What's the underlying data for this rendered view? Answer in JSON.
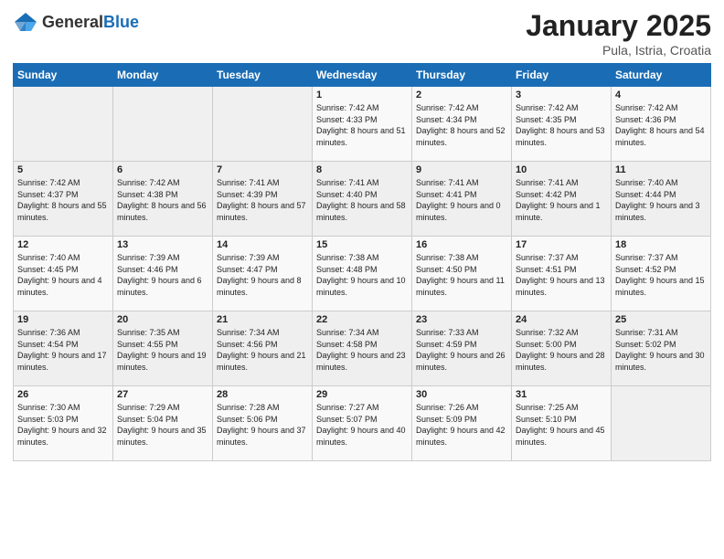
{
  "logo": {
    "general": "General",
    "blue": "Blue"
  },
  "header": {
    "title": "January 2025",
    "subtitle": "Pula, Istria, Croatia"
  },
  "weekdays": [
    "Sunday",
    "Monday",
    "Tuesday",
    "Wednesday",
    "Thursday",
    "Friday",
    "Saturday"
  ],
  "weeks": [
    [
      {
        "day": "",
        "info": ""
      },
      {
        "day": "",
        "info": ""
      },
      {
        "day": "",
        "info": ""
      },
      {
        "day": "1",
        "info": "Sunrise: 7:42 AM\nSunset: 4:33 PM\nDaylight: 8 hours and 51 minutes."
      },
      {
        "day": "2",
        "info": "Sunrise: 7:42 AM\nSunset: 4:34 PM\nDaylight: 8 hours and 52 minutes."
      },
      {
        "day": "3",
        "info": "Sunrise: 7:42 AM\nSunset: 4:35 PM\nDaylight: 8 hours and 53 minutes."
      },
      {
        "day": "4",
        "info": "Sunrise: 7:42 AM\nSunset: 4:36 PM\nDaylight: 8 hours and 54 minutes."
      }
    ],
    [
      {
        "day": "5",
        "info": "Sunrise: 7:42 AM\nSunset: 4:37 PM\nDaylight: 8 hours and 55 minutes."
      },
      {
        "day": "6",
        "info": "Sunrise: 7:42 AM\nSunset: 4:38 PM\nDaylight: 8 hours and 56 minutes."
      },
      {
        "day": "7",
        "info": "Sunrise: 7:41 AM\nSunset: 4:39 PM\nDaylight: 8 hours and 57 minutes."
      },
      {
        "day": "8",
        "info": "Sunrise: 7:41 AM\nSunset: 4:40 PM\nDaylight: 8 hours and 58 minutes."
      },
      {
        "day": "9",
        "info": "Sunrise: 7:41 AM\nSunset: 4:41 PM\nDaylight: 9 hours and 0 minutes."
      },
      {
        "day": "10",
        "info": "Sunrise: 7:41 AM\nSunset: 4:42 PM\nDaylight: 9 hours and 1 minute."
      },
      {
        "day": "11",
        "info": "Sunrise: 7:40 AM\nSunset: 4:44 PM\nDaylight: 9 hours and 3 minutes."
      }
    ],
    [
      {
        "day": "12",
        "info": "Sunrise: 7:40 AM\nSunset: 4:45 PM\nDaylight: 9 hours and 4 minutes."
      },
      {
        "day": "13",
        "info": "Sunrise: 7:39 AM\nSunset: 4:46 PM\nDaylight: 9 hours and 6 minutes."
      },
      {
        "day": "14",
        "info": "Sunrise: 7:39 AM\nSunset: 4:47 PM\nDaylight: 9 hours and 8 minutes."
      },
      {
        "day": "15",
        "info": "Sunrise: 7:38 AM\nSunset: 4:48 PM\nDaylight: 9 hours and 10 minutes."
      },
      {
        "day": "16",
        "info": "Sunrise: 7:38 AM\nSunset: 4:50 PM\nDaylight: 9 hours and 11 minutes."
      },
      {
        "day": "17",
        "info": "Sunrise: 7:37 AM\nSunset: 4:51 PM\nDaylight: 9 hours and 13 minutes."
      },
      {
        "day": "18",
        "info": "Sunrise: 7:37 AM\nSunset: 4:52 PM\nDaylight: 9 hours and 15 minutes."
      }
    ],
    [
      {
        "day": "19",
        "info": "Sunrise: 7:36 AM\nSunset: 4:54 PM\nDaylight: 9 hours and 17 minutes."
      },
      {
        "day": "20",
        "info": "Sunrise: 7:35 AM\nSunset: 4:55 PM\nDaylight: 9 hours and 19 minutes."
      },
      {
        "day": "21",
        "info": "Sunrise: 7:34 AM\nSunset: 4:56 PM\nDaylight: 9 hours and 21 minutes."
      },
      {
        "day": "22",
        "info": "Sunrise: 7:34 AM\nSunset: 4:58 PM\nDaylight: 9 hours and 23 minutes."
      },
      {
        "day": "23",
        "info": "Sunrise: 7:33 AM\nSunset: 4:59 PM\nDaylight: 9 hours and 26 minutes."
      },
      {
        "day": "24",
        "info": "Sunrise: 7:32 AM\nSunset: 5:00 PM\nDaylight: 9 hours and 28 minutes."
      },
      {
        "day": "25",
        "info": "Sunrise: 7:31 AM\nSunset: 5:02 PM\nDaylight: 9 hours and 30 minutes."
      }
    ],
    [
      {
        "day": "26",
        "info": "Sunrise: 7:30 AM\nSunset: 5:03 PM\nDaylight: 9 hours and 32 minutes."
      },
      {
        "day": "27",
        "info": "Sunrise: 7:29 AM\nSunset: 5:04 PM\nDaylight: 9 hours and 35 minutes."
      },
      {
        "day": "28",
        "info": "Sunrise: 7:28 AM\nSunset: 5:06 PM\nDaylight: 9 hours and 37 minutes."
      },
      {
        "day": "29",
        "info": "Sunrise: 7:27 AM\nSunset: 5:07 PM\nDaylight: 9 hours and 40 minutes."
      },
      {
        "day": "30",
        "info": "Sunrise: 7:26 AM\nSunset: 5:09 PM\nDaylight: 9 hours and 42 minutes."
      },
      {
        "day": "31",
        "info": "Sunrise: 7:25 AM\nSunset: 5:10 PM\nDaylight: 9 hours and 45 minutes."
      },
      {
        "day": "",
        "info": ""
      }
    ]
  ]
}
